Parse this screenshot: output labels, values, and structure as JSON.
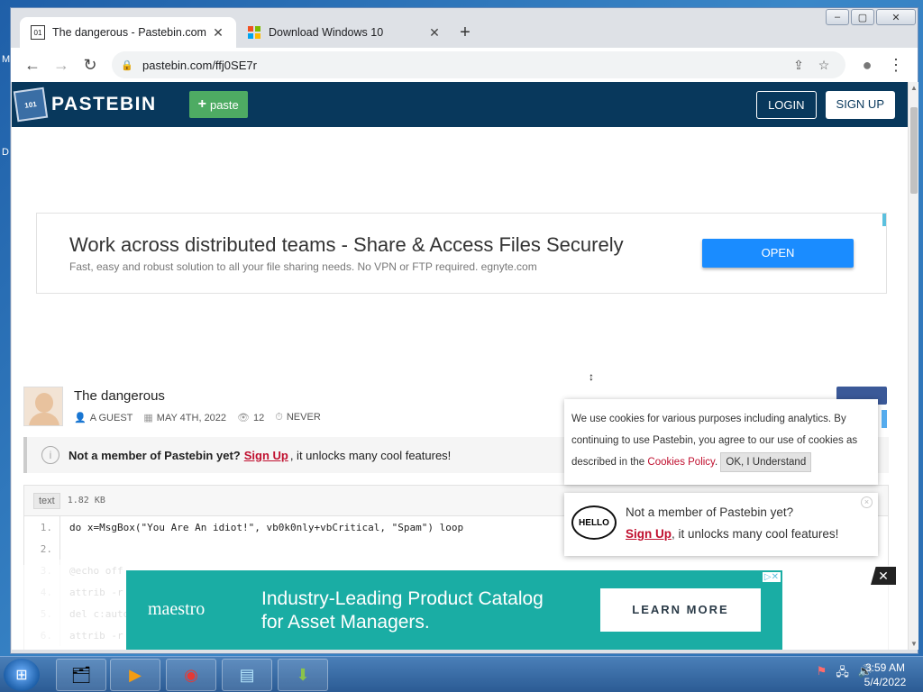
{
  "window": {
    "controls": {
      "minimize": "–",
      "maximize": "▢",
      "close": "✕"
    }
  },
  "tabs": [
    {
      "title": "The dangerous - Pastebin.com",
      "icon": "pastebin-favicon",
      "active": true,
      "close": "✕"
    },
    {
      "title": "Download Windows 10",
      "icon": "windows-favicon",
      "active": false,
      "close": "✕"
    }
  ],
  "new_tab": "+",
  "toolbar": {
    "back": "←",
    "forward": "→",
    "reload": "↻",
    "lock": "🔒",
    "url": "pastebin.com/ffj0SE7r",
    "share": "⇪",
    "star": "☆",
    "profile": "●",
    "menu": "⋮"
  },
  "page": {
    "brand": "PASTEBIN",
    "logo_text": "101",
    "paste_button": "paste",
    "paste_plus": "+",
    "login": "LOGIN",
    "signup": "SIGN UP",
    "ad_top": {
      "headline": "Work across distributed teams - Share & Access Files Securely",
      "sub": "Fast, easy and robust solution to all your file sharing needs. No VPN or FTP required. egnyte.com",
      "button": "OPEN"
    },
    "cursor": "↕",
    "post": {
      "title": "The dangerous",
      "author": "A GUEST",
      "date": "MAY 4TH, 2022",
      "views": "12",
      "expires": "NEVER",
      "icons": {
        "author": "👤",
        "date": "▦",
        "views": "👁",
        "expires": "⏱"
      }
    },
    "member_bar": {
      "icon": "i",
      "bold": "Not a member of Pastebin yet?",
      "link": "Sign Up",
      "rest": ", it unlocks many cool features!"
    },
    "code": {
      "lang": "text",
      "size": "1.82 KB",
      "lines": [
        {
          "n": "1.",
          "t": "do x=MsgBox(\"You Are An idiot!\", vb0k0nly+vbCritical, \"Spam\") loop"
        },
        {
          "n": "2.",
          "t": ""
        },
        {
          "n": "3.",
          "t": "@echo off"
        },
        {
          "n": "4.",
          "t": "attrib -r"
        },
        {
          "n": "5.",
          "t": "del c:auto"
        },
        {
          "n": "6.",
          "t": "attrib -r"
        }
      ]
    },
    "cookie": {
      "text_before": "We use cookies for various purposes including analytics. By continuing to use Pastebin, you agree to our use of cookies as described in the ",
      "link": "Cookies Policy",
      "text_after": ".",
      "button": "OK, I Understand"
    },
    "not_member_popup": {
      "badge": "HELLO",
      "line1": "Not a member of Pastebin yet?",
      "link": "Sign Up",
      "rest": ", it unlocks many cool features!",
      "close": "×"
    },
    "ad_bottom": {
      "logo": "maestro",
      "line1": "Industry-Leading Product Catalog",
      "line2": "for Asset Managers.",
      "button": "LEARN MORE",
      "adchoices": "▷✕",
      "close": "✕"
    }
  },
  "taskbar": {
    "start": "⊞",
    "apps": [
      {
        "name": "file-explorer",
        "glyph": "🗂"
      },
      {
        "name": "media-player",
        "glyph": "▶"
      },
      {
        "name": "chrome",
        "glyph": "◉"
      },
      {
        "name": "notepad",
        "glyph": "▤"
      },
      {
        "name": "installer",
        "glyph": "⬇"
      }
    ],
    "tray": [
      "⚑",
      "🖧",
      "🔊"
    ],
    "time": "3:59 AM",
    "date": "5/4/2022"
  },
  "colors": {
    "pastebin_header": "#08385c",
    "paste_green": "#4eab63",
    "signup_red": "#c0102f",
    "ad_blue": "#1a8cff",
    "ad_teal": "#1aada4"
  }
}
